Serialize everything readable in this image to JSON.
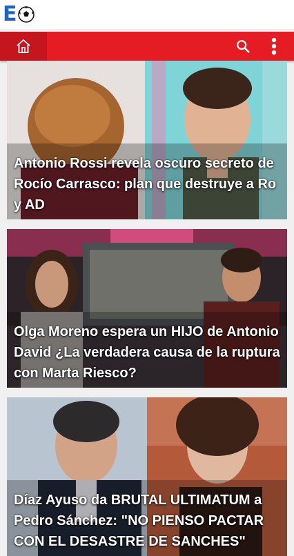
{
  "header": {
    "logo_letter": "E",
    "logo_icon": "soccer-ball-icon",
    "home_icon": "home-icon",
    "search_icon": "search-icon",
    "menu_icon": "more-vert-icon",
    "brand_color": "#e51c23",
    "logo_color": "#1e63c9"
  },
  "articles": [
    {
      "title": "Antonio Rossi revela oscuro secreto de Rocío Carrasco: plan que destruye a Ro y AD"
    },
    {
      "title": "Olga Moreno espera un HIJO de Antonio David ¿La verdadera causa de la ruptura con Marta Riesco?"
    },
    {
      "title": "Díaz Ayuso da BRUTAL ULTIMATUM a Pedro Sánchez: \"NO PIENSO PACTAR CON EL DESASTRE DE SANCHES\""
    }
  ]
}
